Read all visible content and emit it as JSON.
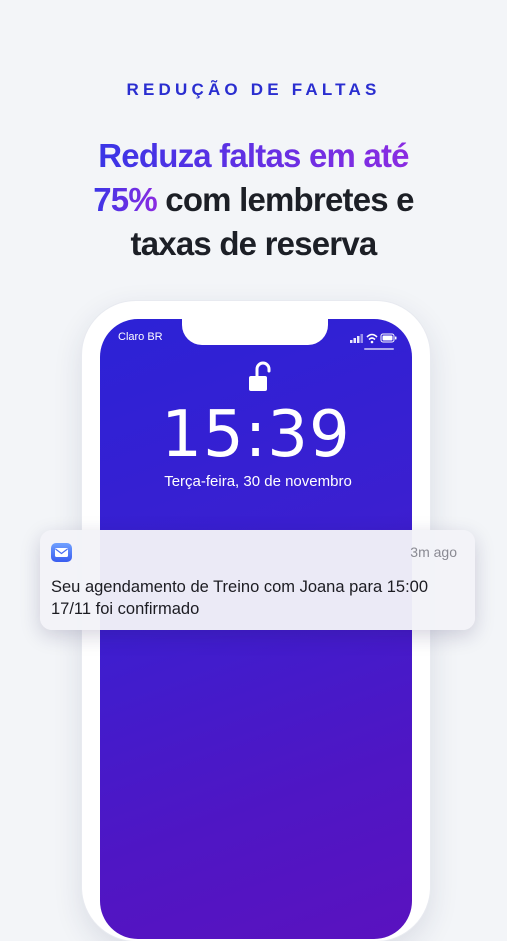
{
  "eyebrow": "REDUÇÃO DE FALTAS",
  "headline": {
    "part1": "Reduza faltas em até",
    "part2_highlight": "75%",
    "part2_rest": " com lembretes e",
    "part3": "taxas de reserva"
  },
  "phone": {
    "carrier": "Claro BR",
    "time": "15:39",
    "date": "Terça-feira, 30 de novembro"
  },
  "notification": {
    "icon": "messages-app-icon",
    "time_ago": "3m ago",
    "message": "Seu agendamento de Treino com Joana para 15:00 17/11 foi confirmado"
  },
  "colors": {
    "accent": "#2a2ed0",
    "highlight_gradient_start": "#3a35e6",
    "highlight_gradient_end": "#8a2be2",
    "screen": "#3b1fd0"
  }
}
